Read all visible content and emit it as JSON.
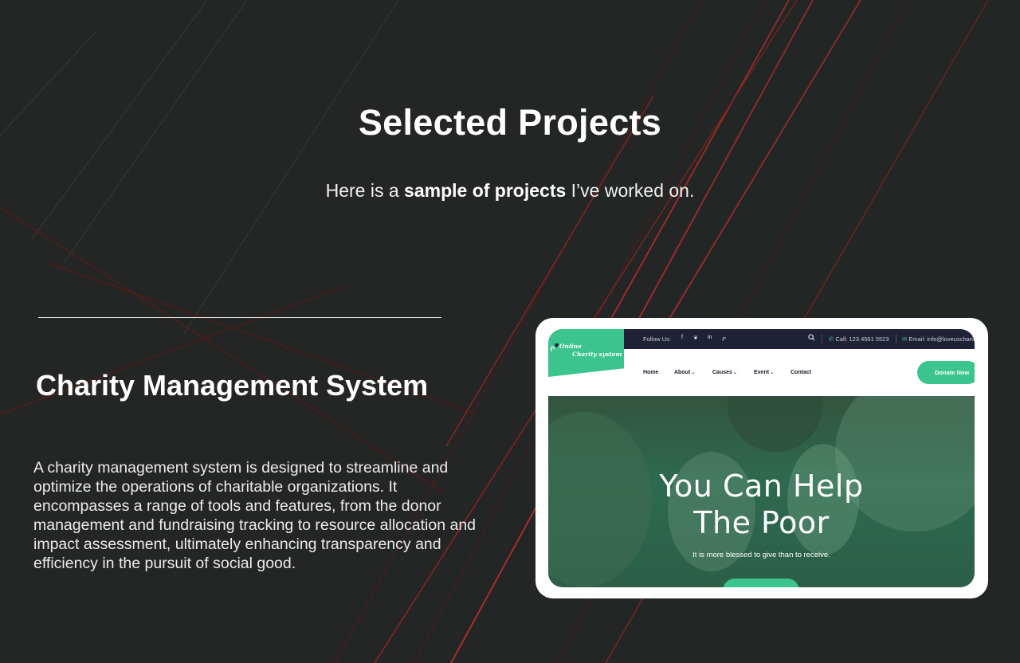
{
  "section": {
    "title": "Selected Projects",
    "subtitle_before": "Here is a ",
    "subtitle_bold": "sample of projects",
    "subtitle_after": " I’ve worked on."
  },
  "project": {
    "title": "Charity Management System",
    "description": "A charity management system is designed to streamline and optimize the operations of charitable organizations. It encompasses a range of tools and features, from the donor management and fundraising tracking to resource allocation and impact assessment, ultimately enhancing transparency and efficiency in the pursuit of social good."
  },
  "preview": {
    "logo_line1": "Online",
    "logo_line2": "Charity system",
    "follow_label": "Follow Us:",
    "social_icons": [
      "facebook-icon",
      "twitter-icon",
      "linkedin-icon",
      "pinterest-icon"
    ],
    "social_glyphs": [
      "f",
      "❦",
      "in",
      "℘"
    ],
    "call_text": "Call:  123 4561 5523",
    "email_text": "Email:  info@loveuscharity",
    "nav": [
      "Home",
      "About",
      "Causes",
      "Event",
      "Contact"
    ],
    "donate_label": "Donate Now",
    "hero_title_line1": "You Can Help",
    "hero_title_line2": "The Poor",
    "hero_subtitle": "It is more blessed to give than to receive."
  },
  "colors": {
    "background": "#222523",
    "accent_green": "#3cc48f",
    "topbar": "#1f2236",
    "light_streak_red": "#e8302a"
  }
}
